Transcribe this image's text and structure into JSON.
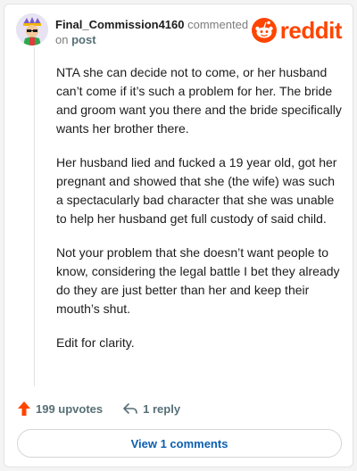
{
  "comment": {
    "username": "Final_Commission4160",
    "action_text": "commented",
    "on_text": "on",
    "post_link": "post",
    "paragraphs": [
      "NTA she can decide not to come, or her husband can’t come if it’s such a problem for her. The bride and groom want you there and the bride specifically wants her brother there.",
      "Her husband lied and fucked a 19 year old, got her pregnant and showed that she (the wife) was such a spectacularly bad character that she was unable to help her husband get full custody of said child.",
      "Not your problem that she doesn’t want people to know, considering the legal battle I bet they already do they are just better than her and keep their mouth’s shut.",
      "Edit for clarity."
    ]
  },
  "brand": {
    "name": "reddit",
    "color": "#ff4500"
  },
  "actions": {
    "upvotes": "199 upvotes",
    "replies": "1 reply"
  },
  "view_button": "View 1 comments",
  "icons": [
    "avatar",
    "reddit-logo-icon",
    "upvote-arrow-icon",
    "reply-arrow-icon"
  ]
}
